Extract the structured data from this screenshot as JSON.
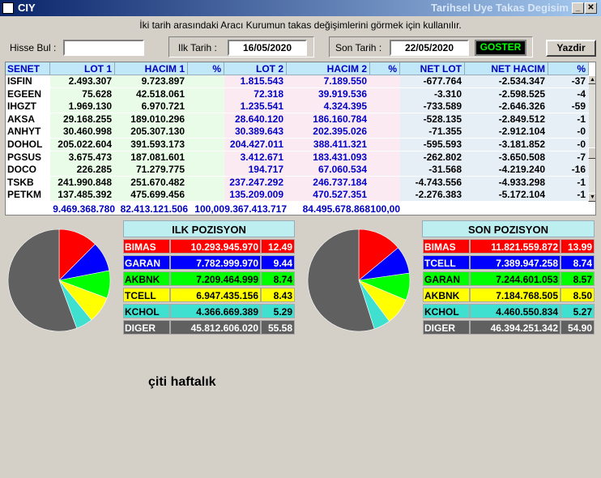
{
  "window": {
    "title": "CIY",
    "subtitle": "Tarihsel Uye Takas Degisim"
  },
  "description": "İki tarih arasındaki  Aracı Kurumun takas değişimlerini görmek için kullanılır.",
  "controls": {
    "hisse_label": "Hisse Bul :",
    "hisse_value": "",
    "ilk_tarih_label": "Ilk Tarih :",
    "ilk_tarih_value": "16/05/2020",
    "son_tarih_label": "Son Tarih :",
    "son_tarih_value": "22/05/2020",
    "goster_label": "GOSTER",
    "yazdir_label": "Yazdir"
  },
  "table": {
    "headers": [
      "SENET",
      "LOT 1",
      "HACIM 1",
      "%",
      "LOT 2",
      "HACIM 2",
      "%",
      "NET LOT",
      "NET HACIM",
      "%"
    ],
    "rows": [
      [
        "ISFIN",
        "2.493.307",
        "9.723.897",
        "",
        "1.815.543",
        "7.189.550",
        "",
        "-677.764",
        "-2.534.347",
        "-37"
      ],
      [
        "EGEEN",
        "75.628",
        "42.518.061",
        "",
        "72.318",
        "39.919.536",
        "",
        "-3.310",
        "-2.598.525",
        "-4"
      ],
      [
        "IHGZT",
        "1.969.130",
        "6.970.721",
        "",
        "1.235.541",
        "4.324.395",
        "",
        "-733.589",
        "-2.646.326",
        "-59"
      ],
      [
        "AKSA",
        "29.168.255",
        "189.010.296",
        "",
        "28.640.120",
        "186.160.784",
        "",
        "-528.135",
        "-2.849.512",
        "-1"
      ],
      [
        "ANHYT",
        "30.460.998",
        "205.307.130",
        "",
        "30.389.643",
        "202.395.026",
        "",
        "-71.355",
        "-2.912.104",
        "-0"
      ],
      [
        "DOHOL",
        "205.022.604",
        "391.593.173",
        "",
        "204.427.011",
        "388.411.321",
        "",
        "-595.593",
        "-3.181.852",
        "-0"
      ],
      [
        "PGSUS",
        "3.675.473",
        "187.081.601",
        "",
        "3.412.671",
        "183.431.093",
        "",
        "-262.802",
        "-3.650.508",
        "-7"
      ],
      [
        "DOCO",
        "226.285",
        "71.279.775",
        "",
        "194.717",
        "67.060.534",
        "",
        "-31.568",
        "-4.219.240",
        "-16"
      ],
      [
        "TSKB",
        "241.990.848",
        "251.670.482",
        "",
        "237.247.292",
        "246.737.184",
        "",
        "-4.743.556",
        "-4.933.298",
        "-1"
      ],
      [
        "PETKM",
        "137.485.392",
        "475.699.456",
        "",
        "135.209.009",
        "470.527.351",
        "",
        "-2.276.383",
        "-5.172.104",
        "-1"
      ]
    ],
    "totals": {
      "lot1": "9.469.368.780",
      "hacim1": "82.413.121.506",
      "pct1": "100,00",
      "lot2": "9.367.413.717",
      "hacim2": "84.495.678.868",
      "pct2": "100,00"
    }
  },
  "ilk_pozisyon": {
    "title": "ILK POZISYON",
    "rows": [
      {
        "name": "BIMAS",
        "value": "10.293.945.970",
        "pct": "12.49",
        "pct_num": 12.49,
        "bg": "#ff0000",
        "fg": "#ffffff"
      },
      {
        "name": "GARAN",
        "value": "7.782.999.970",
        "pct": "9.44",
        "pct_num": 9.44,
        "bg": "#0000ff",
        "fg": "#ffffff"
      },
      {
        "name": "AKBNK",
        "value": "7.209.464.999",
        "pct": "8.74",
        "pct_num": 8.74,
        "bg": "#00ff00",
        "fg": "#000000"
      },
      {
        "name": "TCELL",
        "value": "6.947.435.156",
        "pct": "8.43",
        "pct_num": 8.43,
        "bg": "#ffff00",
        "fg": "#000000"
      },
      {
        "name": "KCHOL",
        "value": "4.366.669.389",
        "pct": "5.29",
        "pct_num": 5.29,
        "bg": "#40e0d0",
        "fg": "#000000"
      },
      {
        "name": "DIGER",
        "value": "45.812.606.020",
        "pct": "55.58",
        "pct_num": 55.58,
        "bg": "#606060",
        "fg": "#ffffff"
      }
    ]
  },
  "son_pozisyon": {
    "title": "SON POZISYON",
    "rows": [
      {
        "name": "BIMAS",
        "value": "11.821.559.872",
        "pct": "13.99",
        "pct_num": 13.99,
        "bg": "#ff0000",
        "fg": "#ffffff"
      },
      {
        "name": "TCELL",
        "value": "7.389.947.258",
        "pct": "8.74",
        "pct_num": 8.74,
        "bg": "#0000ff",
        "fg": "#ffffff"
      },
      {
        "name": "GARAN",
        "value": "7.244.601.053",
        "pct": "8.57",
        "pct_num": 8.57,
        "bg": "#00ff00",
        "fg": "#000000"
      },
      {
        "name": "AKBNK",
        "value": "7.184.768.505",
        "pct": "8.50",
        "pct_num": 8.5,
        "bg": "#ffff00",
        "fg": "#000000"
      },
      {
        "name": "KCHOL",
        "value": "4.460.550.834",
        "pct": "5.27",
        "pct_num": 5.27,
        "bg": "#40e0d0",
        "fg": "#000000"
      },
      {
        "name": "DIGER",
        "value": "46.394.251.342",
        "pct": "54.90",
        "pct_num": 54.9,
        "bg": "#606060",
        "fg": "#ffffff"
      }
    ]
  },
  "caption": "çiti haftalık"
}
